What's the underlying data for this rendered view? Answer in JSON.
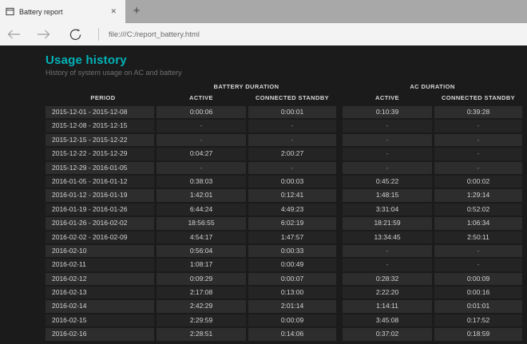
{
  "browser": {
    "tab": {
      "title": "Battery report"
    },
    "icons": {
      "close_tab": "✕",
      "new_tab": "+"
    },
    "url": "file:///C:/report_battery.html"
  },
  "page": {
    "title": "Usage history",
    "subtitle": "History of system usage on AC and battery",
    "colors": {
      "accent": "#00b2b8",
      "page_bg": "#1b1b1b",
      "row_odd": "#2d2d2d",
      "row_even": "#242424"
    }
  },
  "table": {
    "group_headers": [
      "BATTERY DURATION",
      "AC DURATION"
    ],
    "columns": [
      "PERIOD",
      "ACTIVE",
      "CONNECTED STANDBY",
      "ACTIVE",
      "CONNECTED STANDBY"
    ],
    "rows": [
      {
        "period": "2015-12-01 - 2015-12-08",
        "battery_active": "0:00:06",
        "battery_cs": "0:00:01",
        "ac_active": "0:10:39",
        "ac_cs": "0:39:28"
      },
      {
        "period": "2015-12-08 - 2015-12-15",
        "battery_active": "-",
        "battery_cs": "-",
        "ac_active": "-",
        "ac_cs": "-"
      },
      {
        "period": "2015-12-15 - 2015-12-22",
        "battery_active": "-",
        "battery_cs": "-",
        "ac_active": "-",
        "ac_cs": "-"
      },
      {
        "period": "2015-12-22 - 2015-12-29",
        "battery_active": "0:04:27",
        "battery_cs": "2:00:27",
        "ac_active": "-",
        "ac_cs": "-"
      },
      {
        "period": "2015-12-29 - 2016-01-05",
        "battery_active": "-",
        "battery_cs": "-",
        "ac_active": "-",
        "ac_cs": "-"
      },
      {
        "period": "2016-01-05 - 2016-01-12",
        "battery_active": "0:38:03",
        "battery_cs": "0:00:03",
        "ac_active": "0:45:22",
        "ac_cs": "0:00:02"
      },
      {
        "period": "2016-01-12 - 2016-01-19",
        "battery_active": "1:42:01",
        "battery_cs": "0:12:41",
        "ac_active": "1:48:15",
        "ac_cs": "1:29:14"
      },
      {
        "period": "2016-01-19 - 2016-01-26",
        "battery_active": "6:44:24",
        "battery_cs": "4:49:23",
        "ac_active": "3:31:04",
        "ac_cs": "0:52:02"
      },
      {
        "period": "2016-01-26 - 2016-02-02",
        "battery_active": "18:56:55",
        "battery_cs": "6:02:19",
        "ac_active": "18:21:59",
        "ac_cs": "1:06:34"
      },
      {
        "period": "2016-02-02 - 2016-02-09",
        "battery_active": "4:54:17",
        "battery_cs": "1:47:57",
        "ac_active": "13:34:45",
        "ac_cs": "2:50:11"
      },
      {
        "period": "2016-02-10",
        "battery_active": "0:56:04",
        "battery_cs": "0:00:33",
        "ac_active": "-",
        "ac_cs": "-"
      },
      {
        "period": "2016-02-11",
        "battery_active": "1:08:17",
        "battery_cs": "0:00:49",
        "ac_active": "-",
        "ac_cs": "-"
      },
      {
        "period": "2016-02-12",
        "battery_active": "0:09:29",
        "battery_cs": "0:00:07",
        "ac_active": "0:28:32",
        "ac_cs": "0:00:09"
      },
      {
        "period": "2016-02-13",
        "battery_active": "2:17:08",
        "battery_cs": "0:13:00",
        "ac_active": "2:22:20",
        "ac_cs": "0:00:16"
      },
      {
        "period": "2016-02-14",
        "battery_active": "2:42:29",
        "battery_cs": "2:01:14",
        "ac_active": "1:14:11",
        "ac_cs": "0:01:01"
      },
      {
        "period": "2016-02-15",
        "battery_active": "2:29:59",
        "battery_cs": "0:00:09",
        "ac_active": "3:45:08",
        "ac_cs": "0:17:52"
      },
      {
        "period": "2016-02-16",
        "battery_active": "2:28:51",
        "battery_cs": "0:14:06",
        "ac_active": "0:37:02",
        "ac_cs": "0:18:59"
      }
    ]
  }
}
